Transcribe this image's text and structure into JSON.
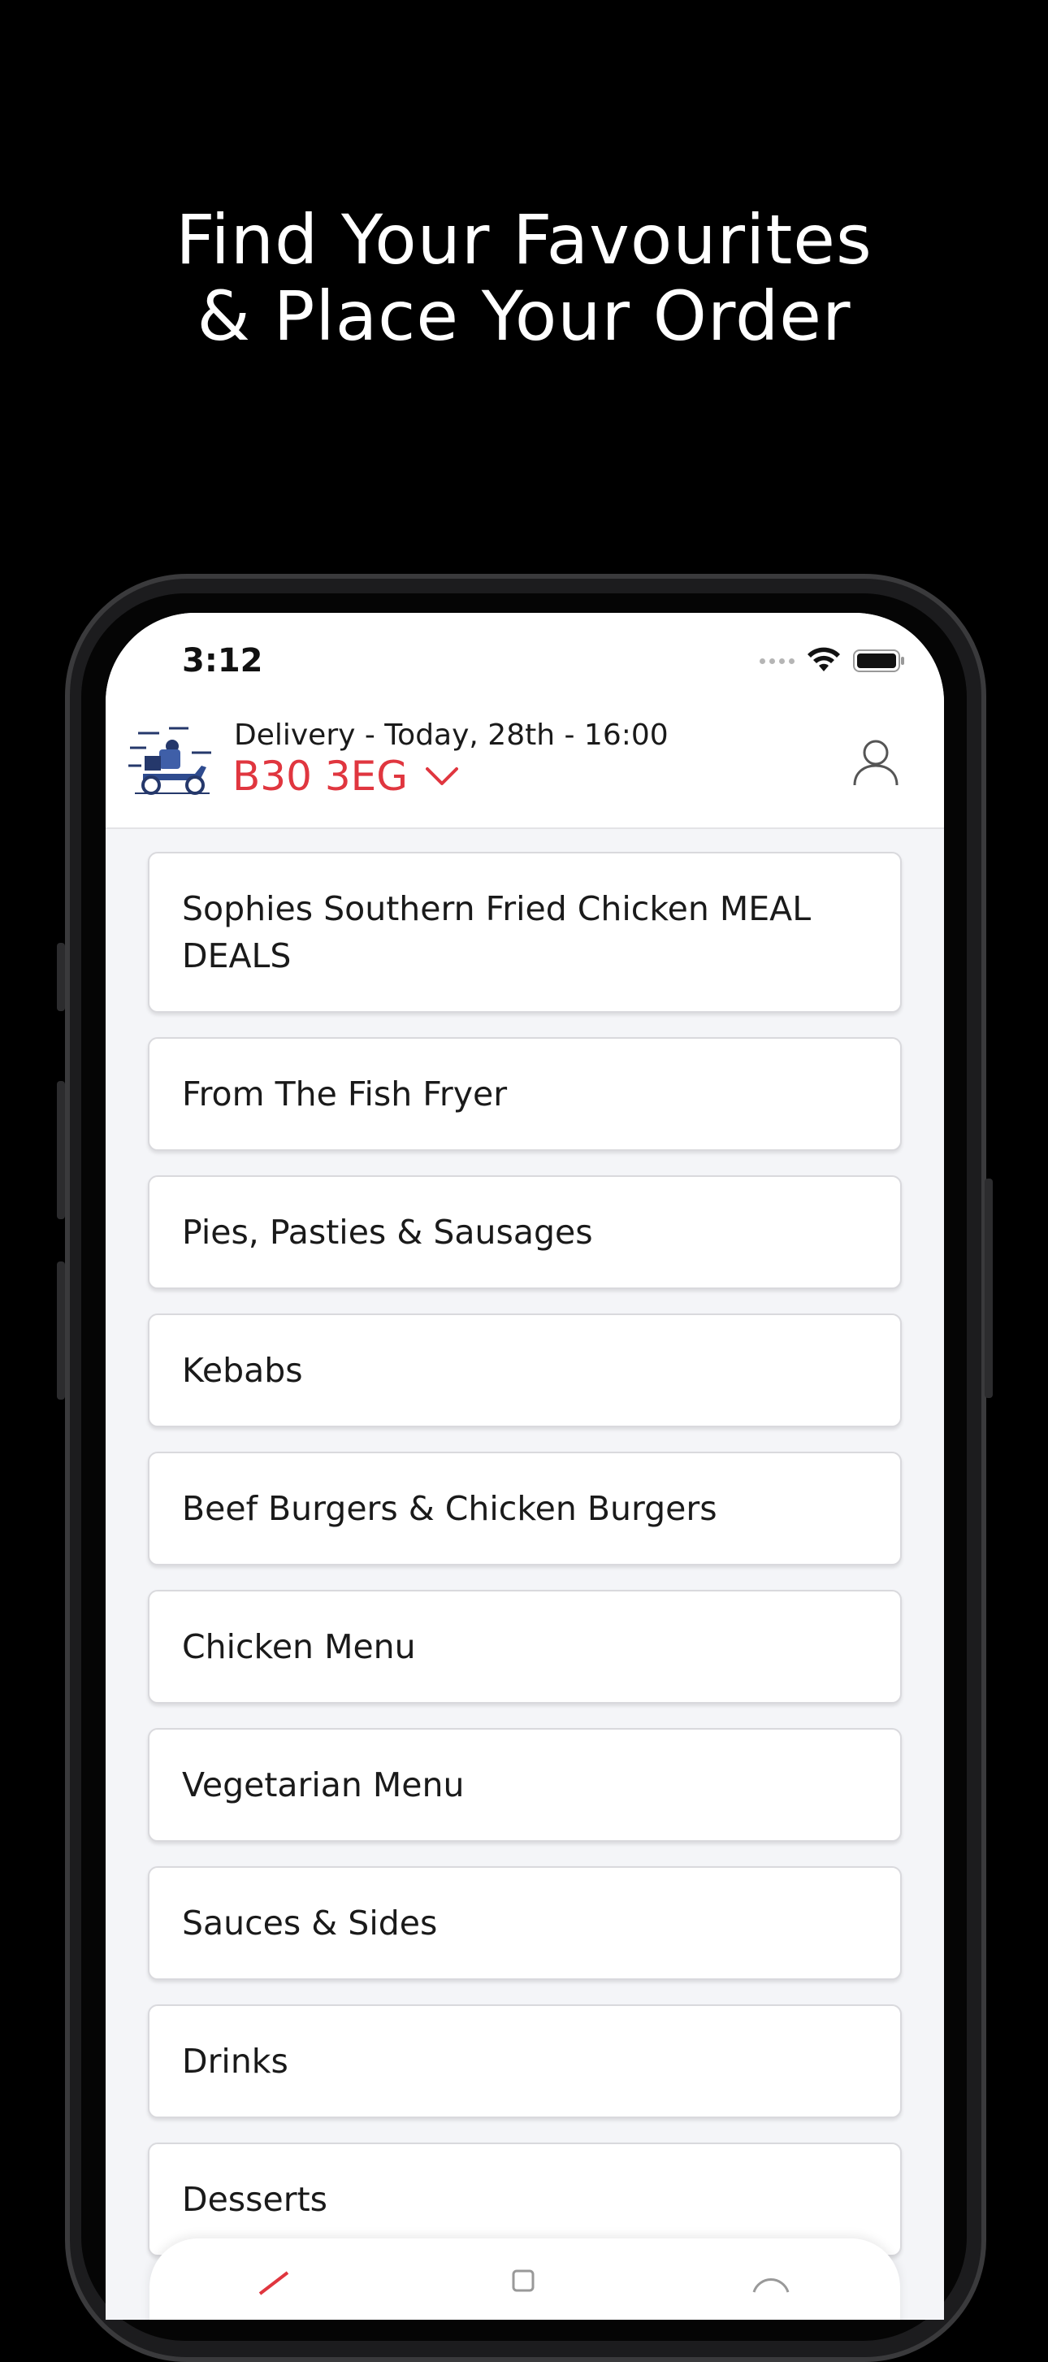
{
  "headline": {
    "line1": "Find Your Favourites",
    "line2": "& Place Your Order"
  },
  "status_bar": {
    "time": "3:12"
  },
  "header": {
    "delivery_info": "Delivery - Today, 28th - 16:00",
    "postcode": "B30 3EG"
  },
  "menu": {
    "items": [
      {
        "label": "Sophies Southern Fried Chicken MEAL DEALS"
      },
      {
        "label": "From The Fish Fryer"
      },
      {
        "label": "Pies, Pasties & Sausages"
      },
      {
        "label": "Kebabs"
      },
      {
        "label": "Beef Burgers & Chicken Burgers"
      },
      {
        "label": "Chicken Menu"
      },
      {
        "label": "Vegetarian Menu"
      },
      {
        "label": "Sauces & Sides"
      },
      {
        "label": "Drinks"
      },
      {
        "label": "Desserts"
      }
    ]
  },
  "colors": {
    "accent": "#e0363f",
    "background": "#000000",
    "screen_bg": "#f4f5f8"
  },
  "icons": {
    "header_left": "delivery-scooter-icon",
    "postcode_toggle": "chevron-down-icon",
    "header_right": "user-icon"
  }
}
